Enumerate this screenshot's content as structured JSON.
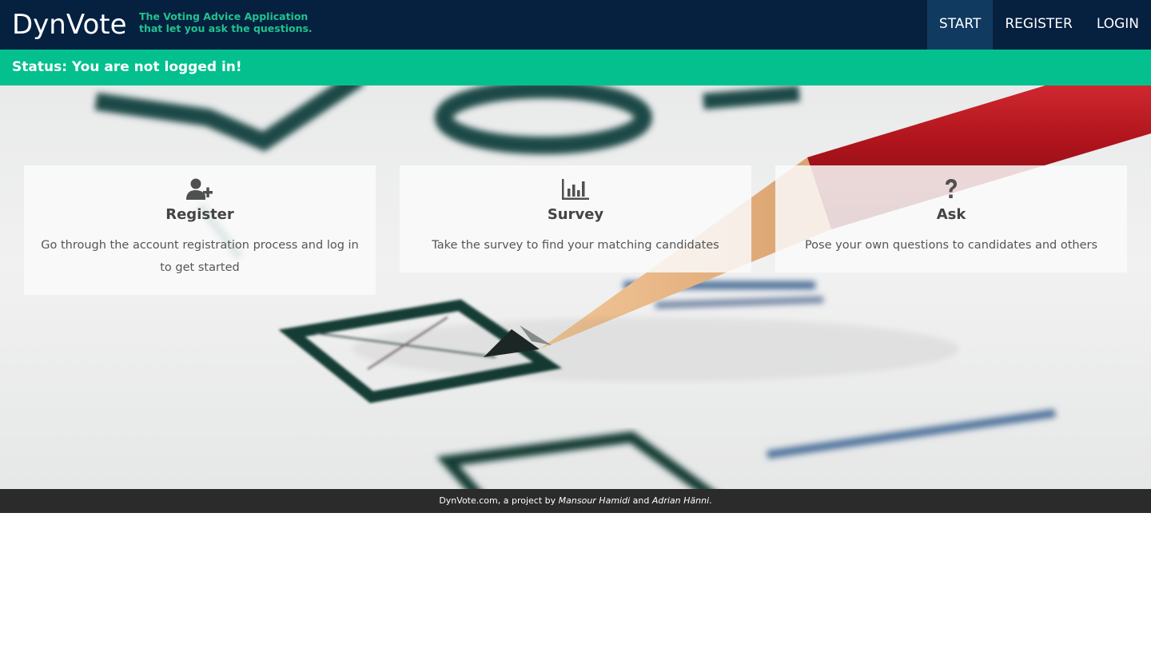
{
  "header": {
    "brand": "DynVote",
    "tagline_line1": "The Voting Advice Application",
    "tagline_line2": "that let you ask the questions.",
    "nav": [
      {
        "label": "START",
        "active": true
      },
      {
        "label": "REGISTER",
        "active": false
      },
      {
        "label": "LOGIN",
        "active": false
      }
    ]
  },
  "status": {
    "text": "Status: You are not logged in!"
  },
  "cards": [
    {
      "icon": "user-plus-icon",
      "title": "Register",
      "description": "Go through the account registration process and log in to get started"
    },
    {
      "icon": "bar-chart-icon",
      "title": "Survey",
      "description": "Take the survey to find your matching candidates"
    },
    {
      "icon": "question-icon",
      "title": "Ask",
      "description": "Pose your own questions to candidates and others"
    }
  ],
  "footer": {
    "prefix": "DynVote.com, a project by ",
    "author1": "Mansour Hamidi",
    "connector": " and ",
    "author2": "Adrian Hänni",
    "suffix": "."
  },
  "colors": {
    "navbar": "#062040",
    "nav_active": "#103a60",
    "status_bar": "#03c08e",
    "tagline": "#20c38d",
    "footer": "#2b2b2b"
  }
}
